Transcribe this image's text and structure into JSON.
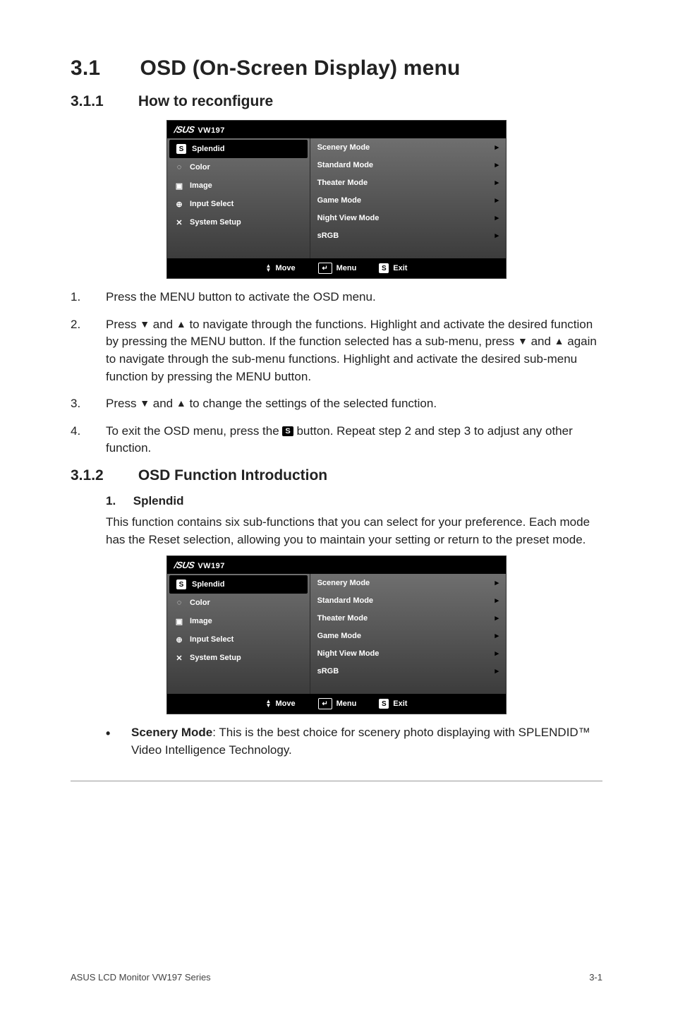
{
  "heading": {
    "number": "3.1",
    "title": "OSD (On-Screen Display) menu"
  },
  "sub1": {
    "number": "3.1.1",
    "title": "How to reconfigure"
  },
  "osd": {
    "model": "VW197",
    "left": {
      "splendid": "Splendid",
      "color": "Color",
      "image": "Image",
      "input_select": "Input Select",
      "system_setup": "System Setup"
    },
    "modes": {
      "scenery": "Scenery Mode",
      "standard": "Standard Mode",
      "theater": "Theater Mode",
      "game": "Game Mode",
      "night": "Night View Mode",
      "srgb": "sRGB"
    },
    "footer": {
      "move": "Move",
      "menu": "Menu",
      "exit": "Exit"
    }
  },
  "steps": {
    "s1": "Press the MENU button to activate the OSD menu.",
    "s2a": "Press ",
    "s2b": " and ",
    "s2c": " to navigate through the functions. Highlight and activate the desired function by pressing the MENU button. If the function selected has a sub-menu, press ",
    "s2d": " and ",
    "s2e": " again to navigate through the sub-menu functions. Highlight and activate the desired sub-menu function by pressing the MENU button.",
    "s3a": "Press ",
    "s3b": " and ",
    "s3c": " to change the settings of the selected function.",
    "s4a": "To exit the OSD menu, press the ",
    "s4b": " button. Repeat step 2 and step 3 to adjust any other function."
  },
  "sub2": {
    "number": "3.1.2",
    "title": "OSD Function Introduction"
  },
  "splendid_section": {
    "idx": "1.",
    "title": "Splendid",
    "desc": "This function contains six sub-functions that you can select for your preference. Each mode has the Reset selection, allowing you to maintain your setting or return to the preset mode."
  },
  "bullet": {
    "scenery_label": "Scenery Mode",
    "scenery_text": ": This is the best choice for scenery photo displaying with SPLENDID™ Video Intelligence Technology."
  },
  "footer": {
    "left": "ASUS LCD Monitor VW197 Series",
    "right": "3-1"
  },
  "glyph": {
    "down": "▼",
    "up": "▲",
    "s": "S",
    "right": "▸",
    "enter": "↵",
    "logo": "/SUS"
  }
}
